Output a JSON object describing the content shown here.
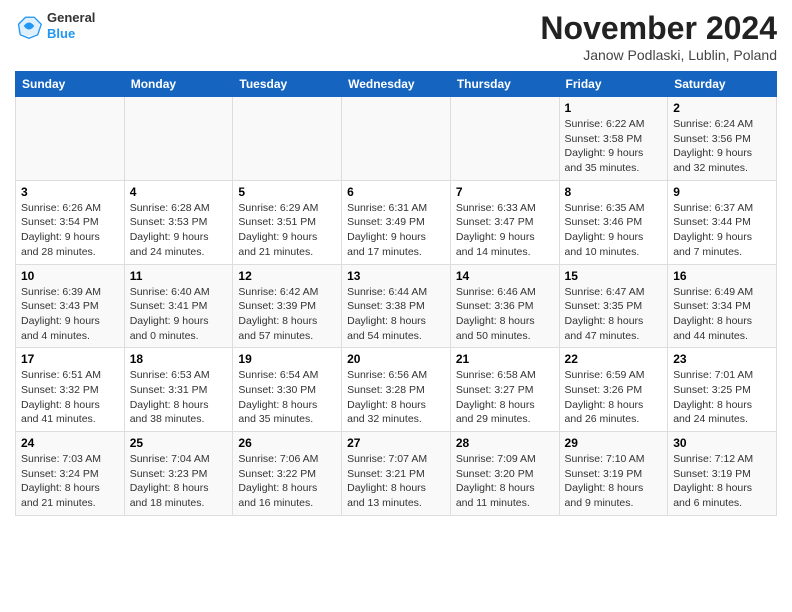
{
  "header": {
    "logo_line1": "General",
    "logo_line2": "Blue",
    "month": "November 2024",
    "location": "Janow Podlaski, Lublin, Poland"
  },
  "weekdays": [
    "Sunday",
    "Monday",
    "Tuesday",
    "Wednesday",
    "Thursday",
    "Friday",
    "Saturday"
  ],
  "weeks": [
    [
      {
        "day": "",
        "info": ""
      },
      {
        "day": "",
        "info": ""
      },
      {
        "day": "",
        "info": ""
      },
      {
        "day": "",
        "info": ""
      },
      {
        "day": "",
        "info": ""
      },
      {
        "day": "1",
        "info": "Sunrise: 6:22 AM\nSunset: 3:58 PM\nDaylight: 9 hours\nand 35 minutes."
      },
      {
        "day": "2",
        "info": "Sunrise: 6:24 AM\nSunset: 3:56 PM\nDaylight: 9 hours\nand 32 minutes."
      }
    ],
    [
      {
        "day": "3",
        "info": "Sunrise: 6:26 AM\nSunset: 3:54 PM\nDaylight: 9 hours\nand 28 minutes."
      },
      {
        "day": "4",
        "info": "Sunrise: 6:28 AM\nSunset: 3:53 PM\nDaylight: 9 hours\nand 24 minutes."
      },
      {
        "day": "5",
        "info": "Sunrise: 6:29 AM\nSunset: 3:51 PM\nDaylight: 9 hours\nand 21 minutes."
      },
      {
        "day": "6",
        "info": "Sunrise: 6:31 AM\nSunset: 3:49 PM\nDaylight: 9 hours\nand 17 minutes."
      },
      {
        "day": "7",
        "info": "Sunrise: 6:33 AM\nSunset: 3:47 PM\nDaylight: 9 hours\nand 14 minutes."
      },
      {
        "day": "8",
        "info": "Sunrise: 6:35 AM\nSunset: 3:46 PM\nDaylight: 9 hours\nand 10 minutes."
      },
      {
        "day": "9",
        "info": "Sunrise: 6:37 AM\nSunset: 3:44 PM\nDaylight: 9 hours\nand 7 minutes."
      }
    ],
    [
      {
        "day": "10",
        "info": "Sunrise: 6:39 AM\nSunset: 3:43 PM\nDaylight: 9 hours\nand 4 minutes."
      },
      {
        "day": "11",
        "info": "Sunrise: 6:40 AM\nSunset: 3:41 PM\nDaylight: 9 hours\nand 0 minutes."
      },
      {
        "day": "12",
        "info": "Sunrise: 6:42 AM\nSunset: 3:39 PM\nDaylight: 8 hours\nand 57 minutes."
      },
      {
        "day": "13",
        "info": "Sunrise: 6:44 AM\nSunset: 3:38 PM\nDaylight: 8 hours\nand 54 minutes."
      },
      {
        "day": "14",
        "info": "Sunrise: 6:46 AM\nSunset: 3:36 PM\nDaylight: 8 hours\nand 50 minutes."
      },
      {
        "day": "15",
        "info": "Sunrise: 6:47 AM\nSunset: 3:35 PM\nDaylight: 8 hours\nand 47 minutes."
      },
      {
        "day": "16",
        "info": "Sunrise: 6:49 AM\nSunset: 3:34 PM\nDaylight: 8 hours\nand 44 minutes."
      }
    ],
    [
      {
        "day": "17",
        "info": "Sunrise: 6:51 AM\nSunset: 3:32 PM\nDaylight: 8 hours\nand 41 minutes."
      },
      {
        "day": "18",
        "info": "Sunrise: 6:53 AM\nSunset: 3:31 PM\nDaylight: 8 hours\nand 38 minutes."
      },
      {
        "day": "19",
        "info": "Sunrise: 6:54 AM\nSunset: 3:30 PM\nDaylight: 8 hours\nand 35 minutes."
      },
      {
        "day": "20",
        "info": "Sunrise: 6:56 AM\nSunset: 3:28 PM\nDaylight: 8 hours\nand 32 minutes."
      },
      {
        "day": "21",
        "info": "Sunrise: 6:58 AM\nSunset: 3:27 PM\nDaylight: 8 hours\nand 29 minutes."
      },
      {
        "day": "22",
        "info": "Sunrise: 6:59 AM\nSunset: 3:26 PM\nDaylight: 8 hours\nand 26 minutes."
      },
      {
        "day": "23",
        "info": "Sunrise: 7:01 AM\nSunset: 3:25 PM\nDaylight: 8 hours\nand 24 minutes."
      }
    ],
    [
      {
        "day": "24",
        "info": "Sunrise: 7:03 AM\nSunset: 3:24 PM\nDaylight: 8 hours\nand 21 minutes."
      },
      {
        "day": "25",
        "info": "Sunrise: 7:04 AM\nSunset: 3:23 PM\nDaylight: 8 hours\nand 18 minutes."
      },
      {
        "day": "26",
        "info": "Sunrise: 7:06 AM\nSunset: 3:22 PM\nDaylight: 8 hours\nand 16 minutes."
      },
      {
        "day": "27",
        "info": "Sunrise: 7:07 AM\nSunset: 3:21 PM\nDaylight: 8 hours\nand 13 minutes."
      },
      {
        "day": "28",
        "info": "Sunrise: 7:09 AM\nSunset: 3:20 PM\nDaylight: 8 hours\nand 11 minutes."
      },
      {
        "day": "29",
        "info": "Sunrise: 7:10 AM\nSunset: 3:19 PM\nDaylight: 8 hours\nand 9 minutes."
      },
      {
        "day": "30",
        "info": "Sunrise: 7:12 AM\nSunset: 3:19 PM\nDaylight: 8 hours\nand 6 minutes."
      }
    ]
  ]
}
